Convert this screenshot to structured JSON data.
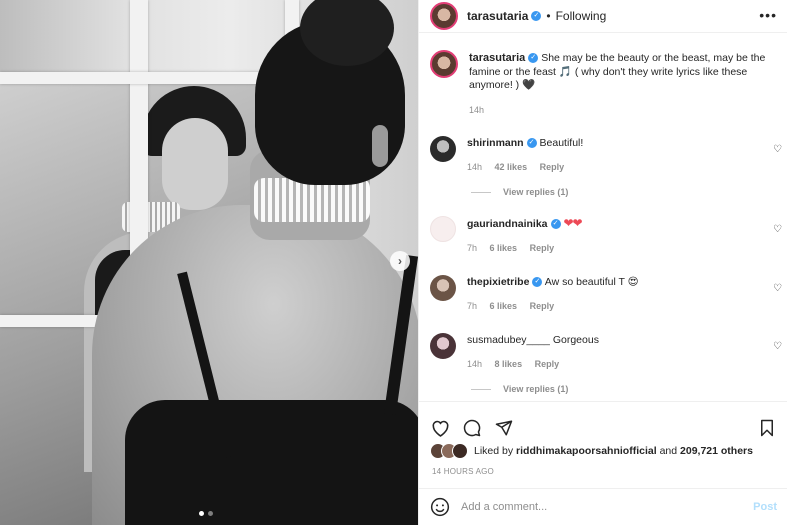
{
  "post": {
    "author": "tarasutaria",
    "follow_sep": "•",
    "follow_status": "Following",
    "more_label": "•••",
    "carousel": {
      "total": 2,
      "current": 1,
      "next_glyph": "›"
    }
  },
  "caption": {
    "username": "tarasutaria",
    "text": "She may be the beauty or the beast, may be the famine or the feast 🎵 ( why don't they write lyrics like these anymore! ) 🖤",
    "time": "14h"
  },
  "comments": [
    {
      "username": "shirinmann",
      "verified": true,
      "text": "Beautiful!",
      "time": "14h",
      "likes": "42 likes",
      "reply": "Reply",
      "view_replies": "View replies (1)"
    },
    {
      "username": "gauriandnainika",
      "verified": true,
      "text": "❤❤",
      "time": "7h",
      "likes": "6 likes",
      "reply": "Reply",
      "view_replies": ""
    },
    {
      "username": "thepixietribe",
      "verified": true,
      "text": "Aw so beautiful T 😍",
      "time": "7h",
      "likes": "6 likes",
      "reply": "Reply",
      "view_replies": ""
    },
    {
      "username": "susmadubey____",
      "verified": false,
      "text": "Gorgeous",
      "time": "14h",
      "likes": "8 likes",
      "reply": "Reply",
      "view_replies": "View replies (1)"
    }
  ],
  "engagement": {
    "liked_by_prefix": "Liked by",
    "liked_by_user": "riddhimakapoorsahniofficial",
    "liked_by_and": "and",
    "others": "209,721 others",
    "posted_ago": "14 HOURS AGO"
  },
  "composer": {
    "placeholder": "Add a comment...",
    "post_label": "Post"
  },
  "icons": {
    "like": "heart-icon",
    "comment": "comment-icon",
    "share": "share-icon",
    "save": "bookmark-icon",
    "emoji": "emoji-icon"
  },
  "colors": {
    "verified": "#3897f0",
    "link_faded": "#b2dffc",
    "meta": "#8e8e8e",
    "story_ring": "#e23e76",
    "heart_red": "#ed4956"
  }
}
